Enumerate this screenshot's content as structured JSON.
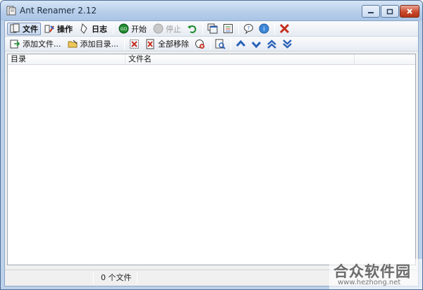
{
  "window": {
    "title": "Ant Renamer 2.12"
  },
  "toolbar1": {
    "file_label": "文件",
    "actions_label": "操作",
    "log_label": "日志",
    "start_label": "开始",
    "stop_label": "停止"
  },
  "toolbar2": {
    "add_files_label": "添加文件...",
    "add_folders_label": "添加目录...",
    "remove_all_label": "全部移除"
  },
  "list": {
    "columns": [
      "目录",
      "文件名",
      ""
    ]
  },
  "statusbar": {
    "count_text": "0 个文件"
  },
  "watermark": {
    "name": "合众软件园",
    "url": "www.hezhong.net"
  },
  "colors": {
    "accent_blue": "#2a62b8",
    "start_green": "#1f8a2c",
    "remove_red": "#c42d1e",
    "titlebar": "#b8cfea"
  }
}
